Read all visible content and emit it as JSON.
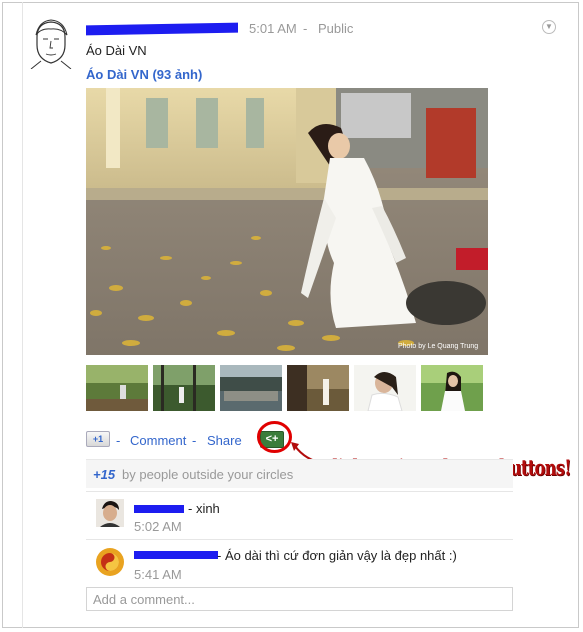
{
  "post": {
    "time": "5:01 AM",
    "separator": "-",
    "visibility": "Public",
    "text": "Áo Dài VN",
    "album_link": "Áo Dài VN (93 ảnh)",
    "photo_credit": "Photo by Le Quang Trung"
  },
  "actions": {
    "plus_one": "+1",
    "separator": "-",
    "comment": "Comment",
    "share": "Share"
  },
  "annotation": {
    "text": "Click to view Share+ buttons!",
    "color": "#b20c0c"
  },
  "plus_ones": {
    "count": "+15",
    "text": "by people outside your circles"
  },
  "comments": [
    {
      "text": "- xinh",
      "time": "5:02 AM"
    },
    {
      "text": "- Áo dài thì cứ đơn giản vậy là đẹp nhất :)",
      "time": "5:41 AM"
    }
  ],
  "add_comment": {
    "placeholder": "Add a comment..."
  },
  "colors": {
    "link": "#3366cc",
    "meta": "#999999",
    "redaction": "#1d1df0"
  }
}
